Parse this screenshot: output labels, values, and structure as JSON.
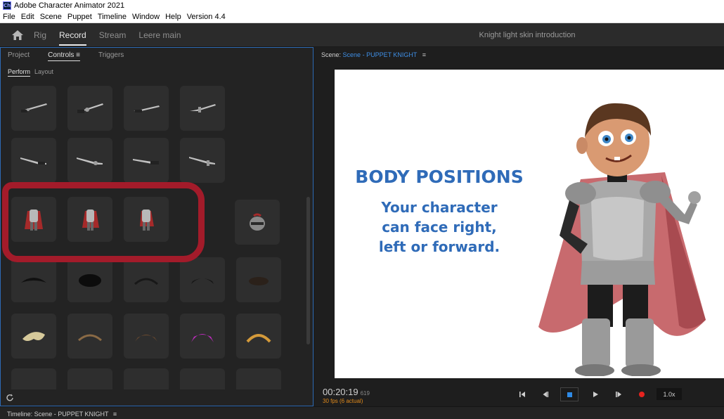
{
  "window": {
    "app_icon_text": "Ch",
    "title": "Adobe Character Animator 2021"
  },
  "menu": [
    "File",
    "Edit",
    "Scene",
    "Puppet",
    "Timeline",
    "Window",
    "Help",
    "Version 4.4"
  ],
  "workspace": {
    "tabs": [
      "Rig",
      "Record",
      "Stream",
      "Leere main"
    ],
    "active_tab": "Record",
    "document_title": "Knight light skin introduction"
  },
  "left_panel": {
    "tabs": [
      "Project",
      "Controls",
      "Triggers"
    ],
    "active_tab": "Controls",
    "controls_menu": "≡",
    "subtabs": [
      "Perform",
      "Layout"
    ],
    "active_subtab": "Perform"
  },
  "scene": {
    "label_prefix": "Scene:",
    "scene_name": "Scene - PUPPET KNIGHT",
    "menu": "≡",
    "stage": {
      "title": "BODY POSITIONS",
      "body_lines": [
        "Your character",
        "can face right,",
        "left or forward."
      ]
    },
    "timecode": "00:20:19",
    "frame": "619",
    "fps": "30 fps (6 actual)",
    "speed": "1.0x"
  },
  "timeline": {
    "label": "Timeline: Scene - PUPPET KNIGHT",
    "menu": "≡"
  },
  "colors": {
    "accent_blue": "#2f6bb8",
    "annotation_red": "#a31b2a",
    "record_red": "#e6231f",
    "fps_orange": "#e08a1c"
  }
}
